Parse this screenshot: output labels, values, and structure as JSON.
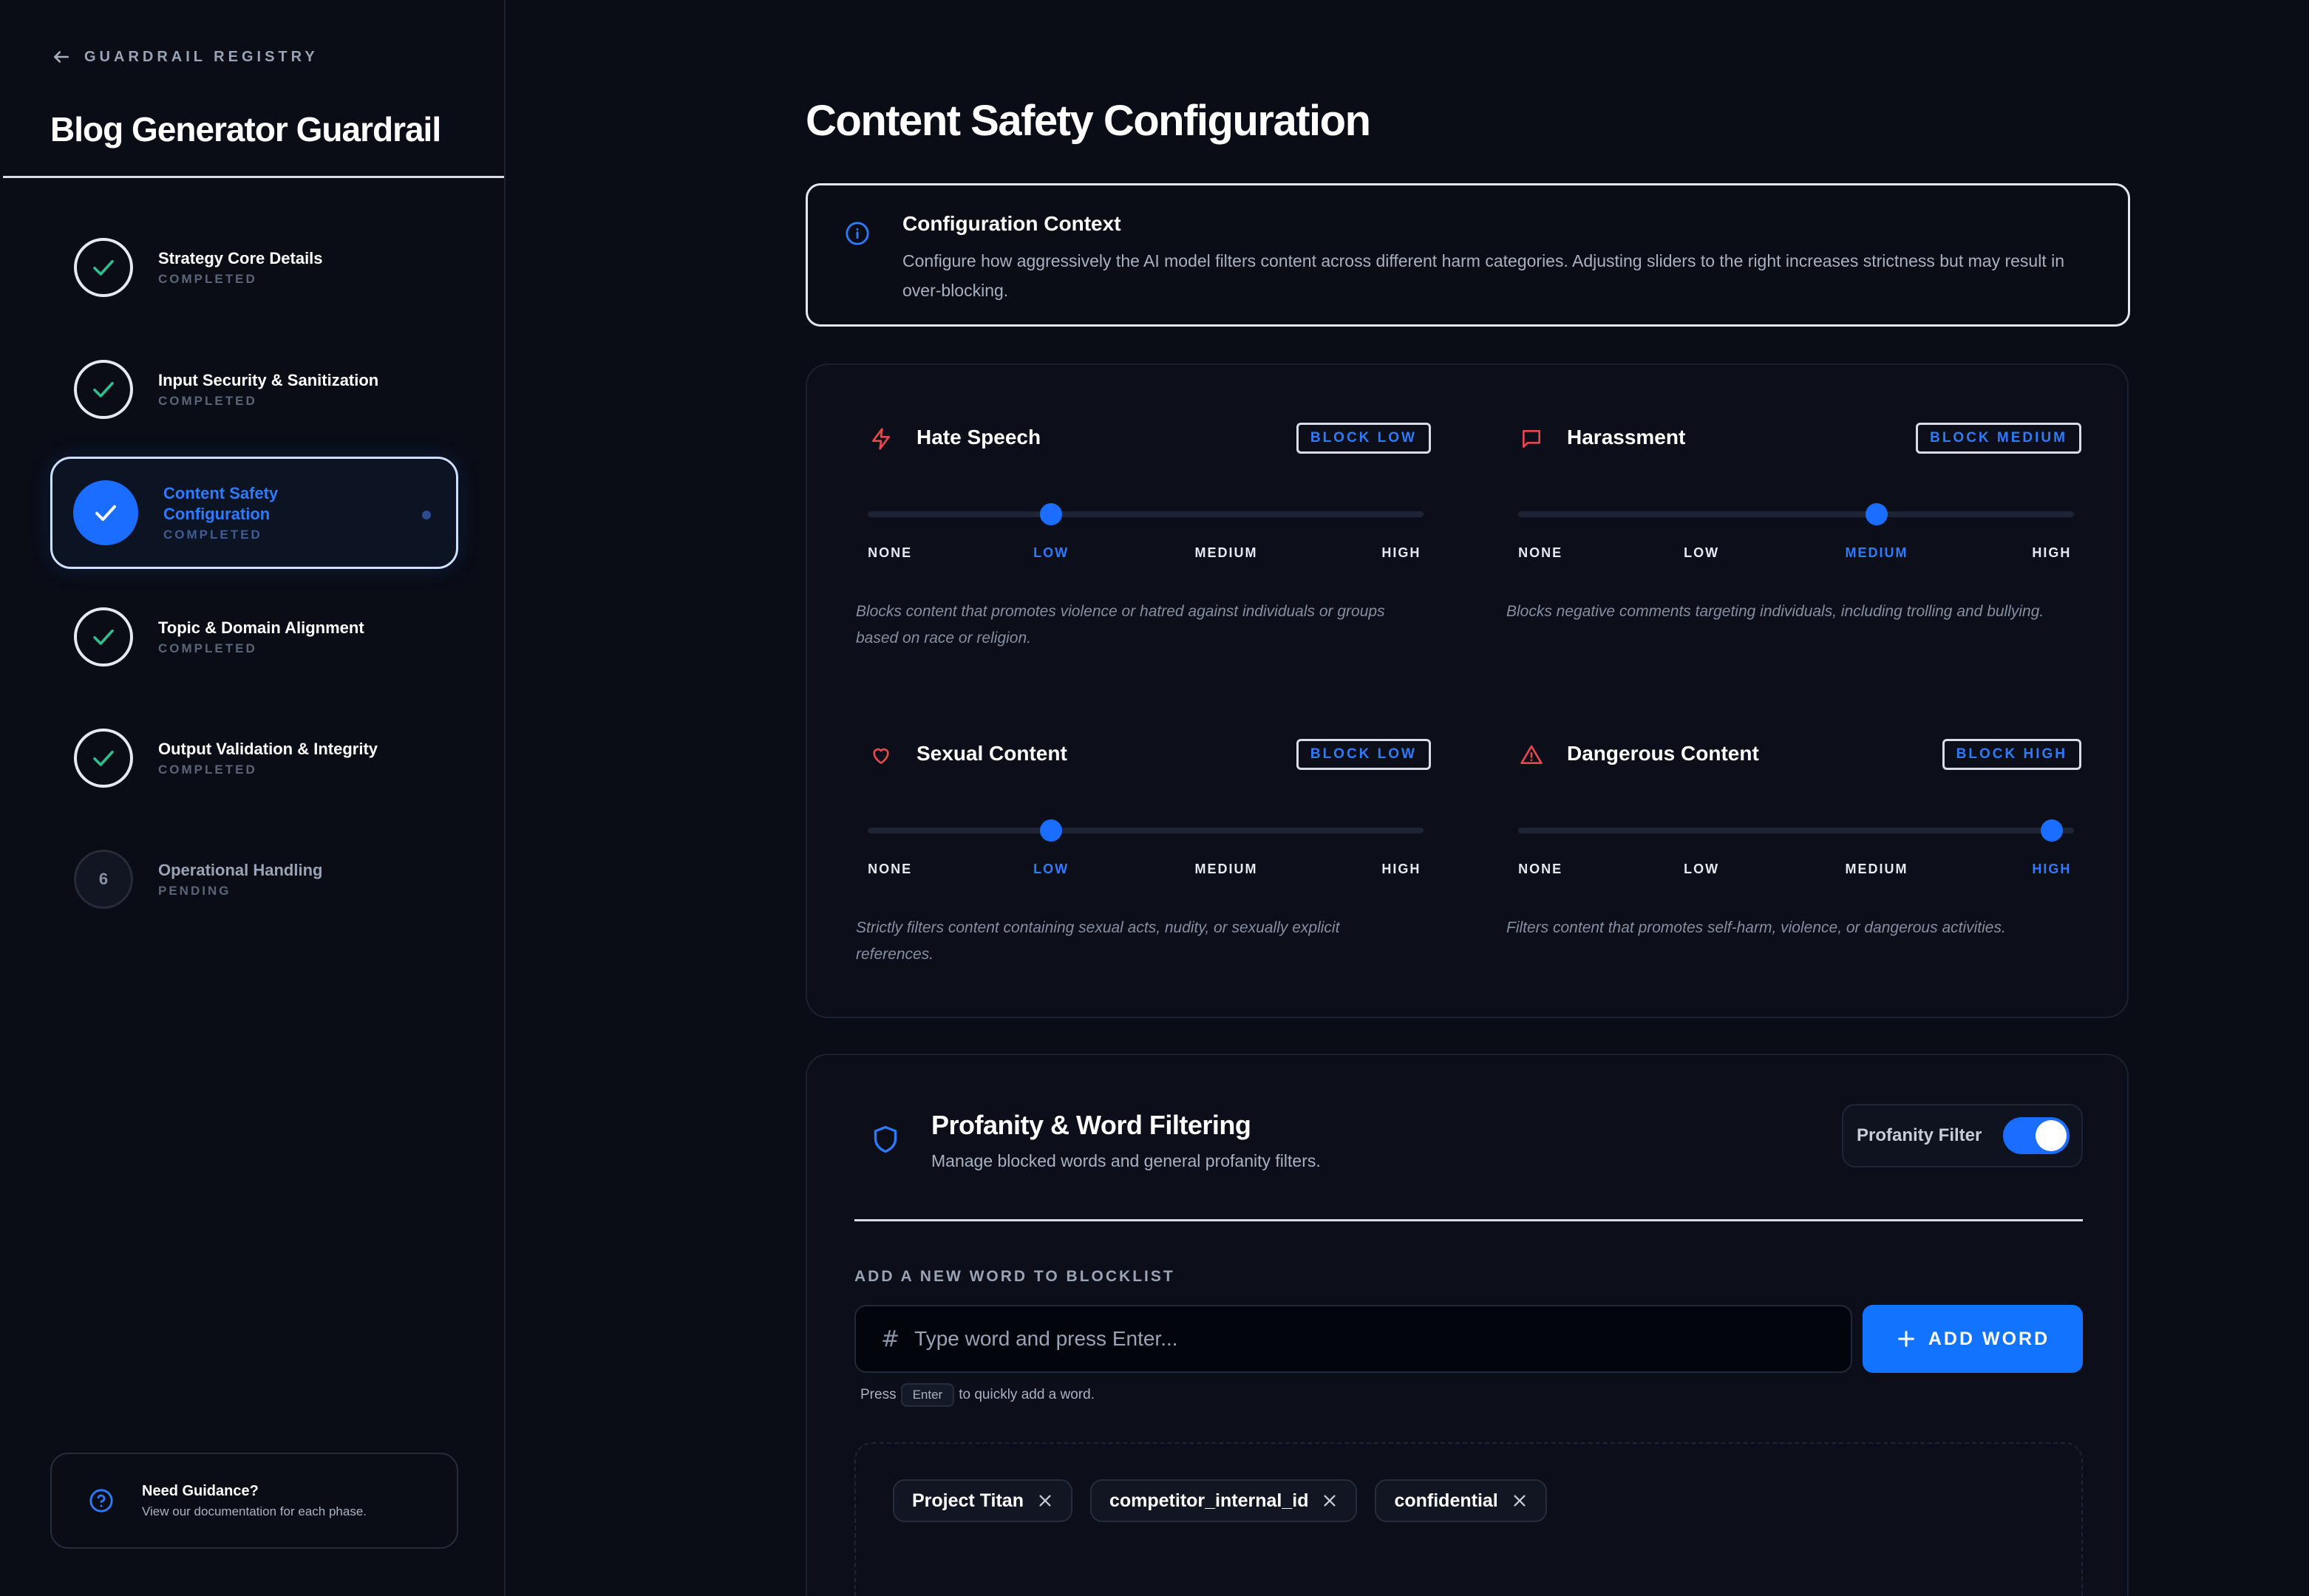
{
  "sidebar": {
    "back_label": "GUARDRAIL REGISTRY",
    "app_title": "Blog Generator Guardrail",
    "steps": [
      {
        "title": "Strategy Core Details",
        "status": "COMPLETED"
      },
      {
        "title": "Input Security & Sanitization",
        "status": "COMPLETED"
      },
      {
        "title_line1": "Content Safety",
        "title_line2": "Configuration",
        "status": "COMPLETED"
      },
      {
        "title": "Topic & Domain Alignment",
        "status": "COMPLETED"
      },
      {
        "title": "Output Validation & Integrity",
        "status": "COMPLETED"
      },
      {
        "number": "6",
        "title": "Operational Handling",
        "status": "PENDING"
      }
    ],
    "guidance": {
      "title": "Need Guidance?",
      "subtitle": "View our documentation for each phase."
    }
  },
  "main": {
    "title": "Content Safety Configuration",
    "context": {
      "title": "Configuration Context",
      "body": "Configure how aggressively the AI model filters content across different harm categories. Adjusting sliders to the right increases strictness but may result in over-blocking."
    },
    "levels": [
      "NONE",
      "LOW",
      "MEDIUM",
      "HIGH"
    ],
    "categories": [
      {
        "name": "Hate Speech",
        "badge": "BLOCK LOW",
        "level": 1,
        "description": "Blocks content that promotes violence or hatred against individuals or groups based on race or religion.",
        "icon": "lightning-icon"
      },
      {
        "name": "Harassment",
        "badge": "BLOCK MEDIUM",
        "level": 2,
        "description": "Blocks negative comments targeting individuals, including trolling and bullying.",
        "icon": "message-icon"
      },
      {
        "name": "Sexual Content",
        "badge": "BLOCK LOW",
        "level": 1,
        "description": "Strictly filters content containing sexual acts, nudity, or sexually explicit references.",
        "icon": "heart-icon"
      },
      {
        "name": "Dangerous Content",
        "badge": "BLOCK HIGH",
        "level": 3,
        "description": "Filters content that promotes self-harm, violence, or dangerous activities.",
        "icon": "warning-icon"
      }
    ],
    "profanity": {
      "title": "Profanity & Word Filtering",
      "subtitle": "Manage blocked words and general profanity filters.",
      "toggle_label": "Profanity Filter",
      "toggle_on": true,
      "add_label": "ADD A NEW WORD TO BLOCKLIST",
      "input_placeholder": "Type word and press Enter...",
      "add_button": "ADD WORD",
      "hint_prefix": "Press",
      "hint_key": "Enter",
      "hint_suffix": "to quickly add a word.",
      "words": [
        "Project Titan",
        "competitor_internal_id",
        "confidential"
      ]
    }
  },
  "colors": {
    "accent": "#1a6dff",
    "success": "#2fbf8f",
    "danger": "#e5484d",
    "background": "#0a0d16"
  }
}
